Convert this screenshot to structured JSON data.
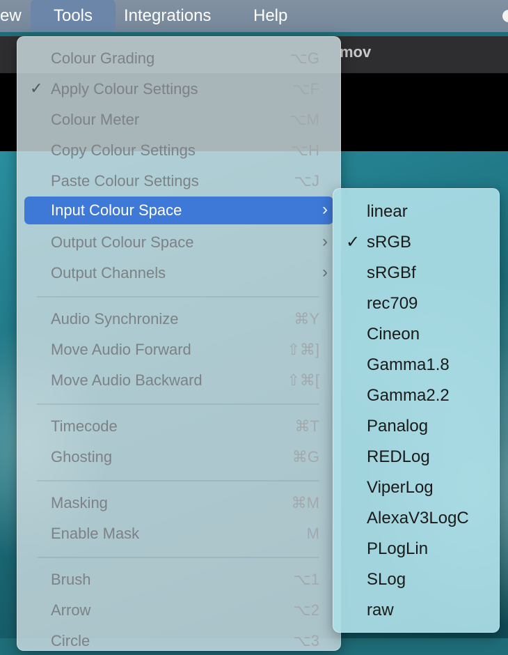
{
  "window": {
    "title_fragment": "mov"
  },
  "menubar": {
    "items": [
      {
        "label": "ew"
      },
      {
        "label": "Tools"
      },
      {
        "label": "Integrations"
      },
      {
        "label": "Help"
      }
    ]
  },
  "tools_menu": {
    "items": [
      {
        "label": "Colour Grading",
        "shortcut": "⌥G"
      },
      {
        "label": "Apply Colour Settings",
        "shortcut": "⌥F",
        "checked": "✓"
      },
      {
        "label": "Colour Meter",
        "shortcut": "⌥M"
      },
      {
        "label": "Copy Colour Settings",
        "shortcut": "⌥H"
      },
      {
        "label": "Paste Colour Settings",
        "shortcut": "⌥J"
      },
      {
        "label": "Input Colour Space",
        "submenu_arrow": "›"
      },
      {
        "label": "Output Colour Space",
        "submenu_arrow": "›"
      },
      {
        "label": "Output Channels",
        "submenu_arrow": "›"
      },
      {
        "label": "Audio Synchronize",
        "shortcut": "⌘Y"
      },
      {
        "label": "Move Audio Forward",
        "shortcut": "⇧⌘]"
      },
      {
        "label": "Move Audio Backward",
        "shortcut": "⇧⌘["
      },
      {
        "label": "Timecode",
        "shortcut": "⌘T"
      },
      {
        "label": "Ghosting",
        "shortcut": "⌘G"
      },
      {
        "label": "Masking",
        "shortcut": "⌘M"
      },
      {
        "label": "Enable Mask",
        "shortcut": "M"
      },
      {
        "label": "Brush",
        "shortcut": "⌥1"
      },
      {
        "label": "Arrow",
        "shortcut": "⌥2"
      },
      {
        "label": "Circle",
        "shortcut": "⌥3"
      }
    ]
  },
  "input_colour_space_submenu": {
    "items": [
      {
        "label": "linear"
      },
      {
        "label": "sRGB",
        "checked": "✓"
      },
      {
        "label": "sRGBf"
      },
      {
        "label": "rec709"
      },
      {
        "label": "Cineon"
      },
      {
        "label": "Gamma1.8"
      },
      {
        "label": "Gamma2.2"
      },
      {
        "label": "Panalog"
      },
      {
        "label": "REDLog"
      },
      {
        "label": "ViperLog"
      },
      {
        "label": "AlexaV3LogC"
      },
      {
        "label": "PLogLin"
      },
      {
        "label": "SLog"
      },
      {
        "label": "raw"
      }
    ]
  },
  "colors": {
    "highlight": "#3e79d8",
    "menubar": "#7c8b9c"
  }
}
